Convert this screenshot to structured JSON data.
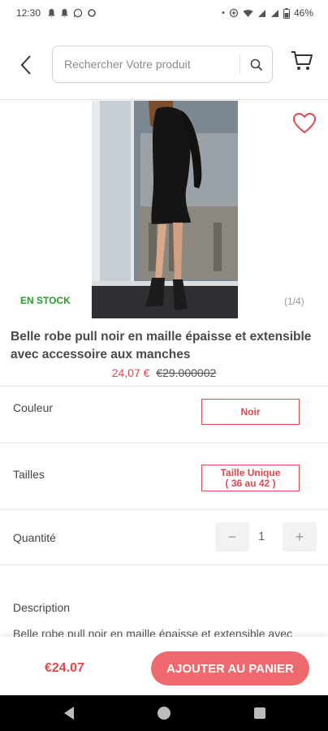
{
  "status_bar": {
    "time": "12:30",
    "battery": "46%"
  },
  "header": {
    "search_placeholder": "Rechercher Votre produit",
    "icons": [
      "back-arrow-icon",
      "search-icon",
      "cart-icon"
    ]
  },
  "product": {
    "stock_label": "EN STOCK",
    "image_pager": "(1/4)",
    "title": "Belle robe pull noir en maille épaisse et extensible avec accessoire aux manches",
    "price": "24,07 €",
    "old_price": "€29.000002"
  },
  "options": {
    "color_label": "Couleur",
    "color_value": "Noir",
    "size_label": "Tailles",
    "size_value_line1": "Taille Unique",
    "size_value_line2": "( 36 au 42 )",
    "quantity_label": "Quantité",
    "quantity_minus": "−",
    "quantity_value": "1",
    "quantity_plus": "+"
  },
  "description": {
    "title": "Description",
    "text": "Belle robe pull noir en maille épaisse et extensible avec"
  },
  "bottom_bar": {
    "price": "€24.07",
    "add_to_cart_label": "AJOUTER AU PANIER"
  },
  "colors": {
    "accent": "#e4484e",
    "button": "#ef6a6e",
    "stock": "#2a9d2a"
  }
}
